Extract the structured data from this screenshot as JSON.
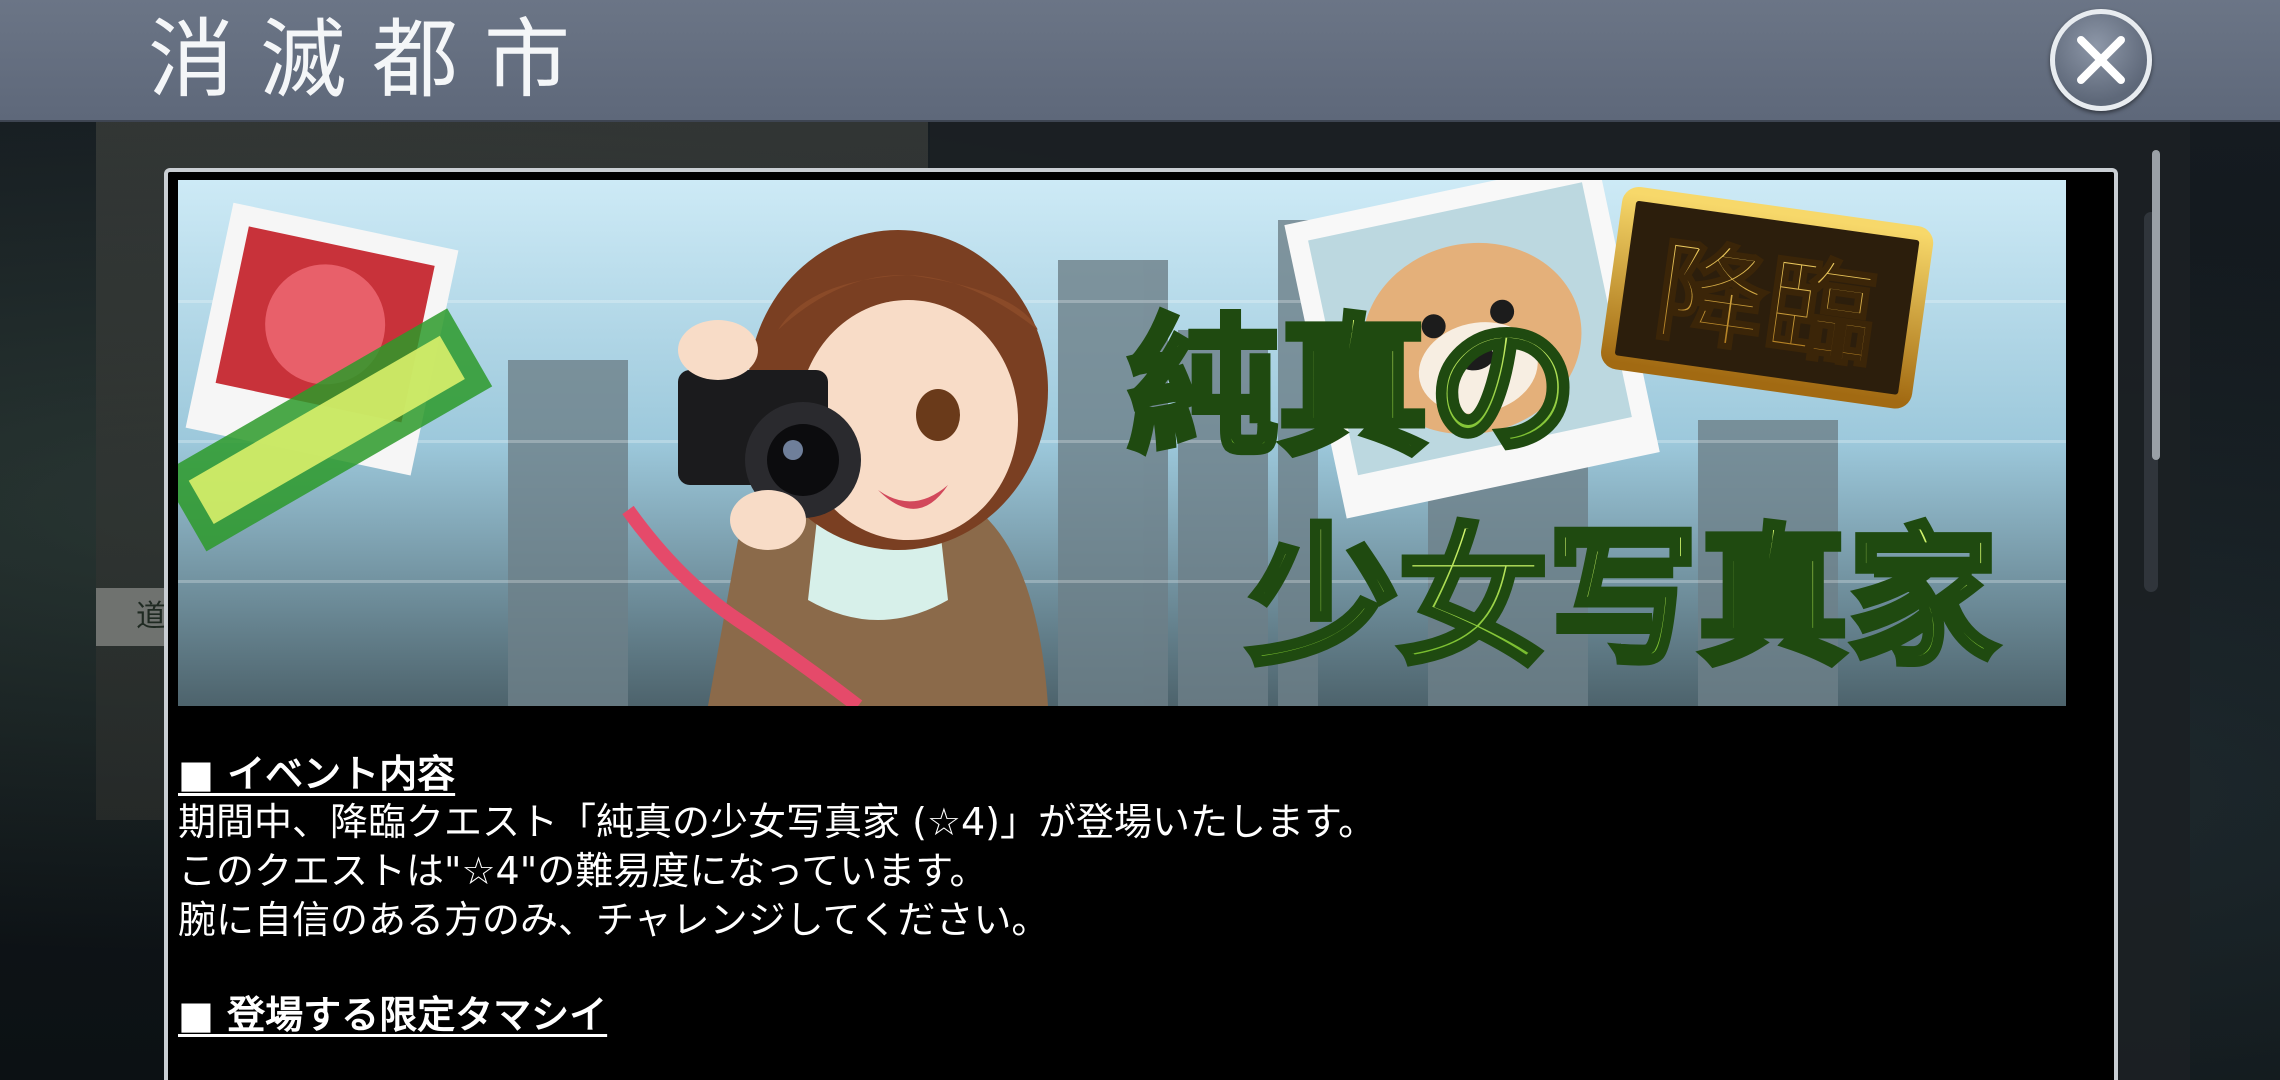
{
  "header": {
    "title": "消滅都市",
    "close_icon": "close-icon"
  },
  "background": {
    "label_fragment": "道"
  },
  "banner": {
    "badge_text": "降臨",
    "title_line1": "純真の",
    "title_line2": "少女写真家"
  },
  "sections": [
    {
      "heading": "■ イベント内容",
      "lines": [
        "期間中、降臨クエスト「純真の少女写真家 (☆4)」が登場いたします。",
        "このクエストは\"☆4\"の難易度になっています。",
        "腕に自信のある方のみ、チャレンジしてください。"
      ]
    },
    {
      "heading": "■ 登場する限定タマシイ",
      "lines": []
    }
  ],
  "colors": {
    "header_bg": "#6b7586",
    "panel_border": "#c9ced3",
    "banner_title_green": "#b6e63a",
    "badge_gold": "#d8a623"
  }
}
